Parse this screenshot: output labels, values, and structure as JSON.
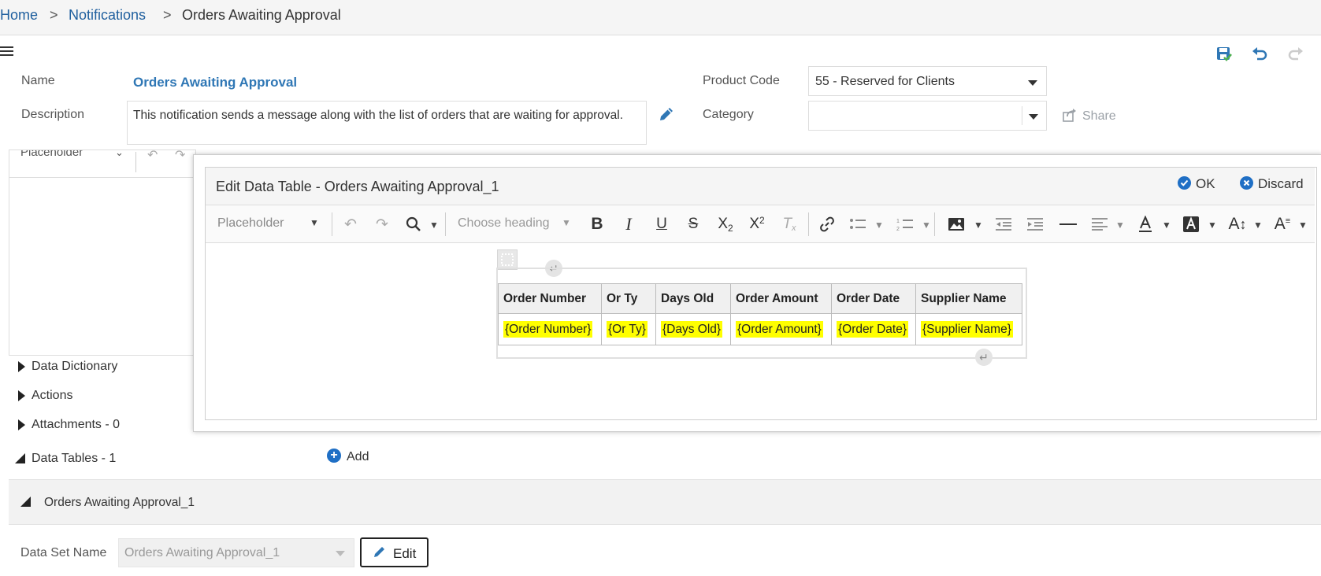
{
  "breadcrumb": {
    "home": "Home",
    "sep1": ">",
    "notifications": "Notifications",
    "sep2": ">",
    "current": "Orders Awaiting Approval"
  },
  "header": {
    "name_label": "Name",
    "name_value": "Orders Awaiting Approval",
    "description_label": "Description",
    "description_value": "This notification sends a message along with the list of orders that are waiting for approval.",
    "product_code_label": "Product Code",
    "product_code_value": "55 - Reserved for Clients",
    "category_label": "Category",
    "category_value": "",
    "share_label": "Share"
  },
  "background_editor": {
    "placeholder_label": "Placeholder"
  },
  "sections": {
    "data_dictionary": "Data Dictionary",
    "actions": "Actions",
    "attachments": "Attachments -  0",
    "data_tables": "Data Tables -  1",
    "add_label": "Add",
    "table_item": "Orders Awaiting Approval_1",
    "data_set_label": "Data Set Name",
    "data_set_value": "Orders Awaiting Approval_1",
    "edit_label": "Edit"
  },
  "modal": {
    "title": "Edit Data Table - Orders Awaiting Approval_1",
    "ok_label": "OK",
    "discard_label": "Discard",
    "toolbar": {
      "placeholder": "Placeholder",
      "heading": "Choose heading"
    },
    "table": {
      "headers": [
        "Order Number",
        "Or Ty",
        "Days Old",
        "Order Amount",
        "Order Date",
        "Supplier Name"
      ],
      "row": [
        "{Order Number}",
        "{Or Ty}",
        "{Days Old}",
        "{Order Amount}",
        "{Order Date}",
        "{Supplier Name}"
      ]
    }
  },
  "colors": {
    "link": "#1f5f9e",
    "accent": "#2f77b5",
    "highlight": "#ffff00"
  }
}
